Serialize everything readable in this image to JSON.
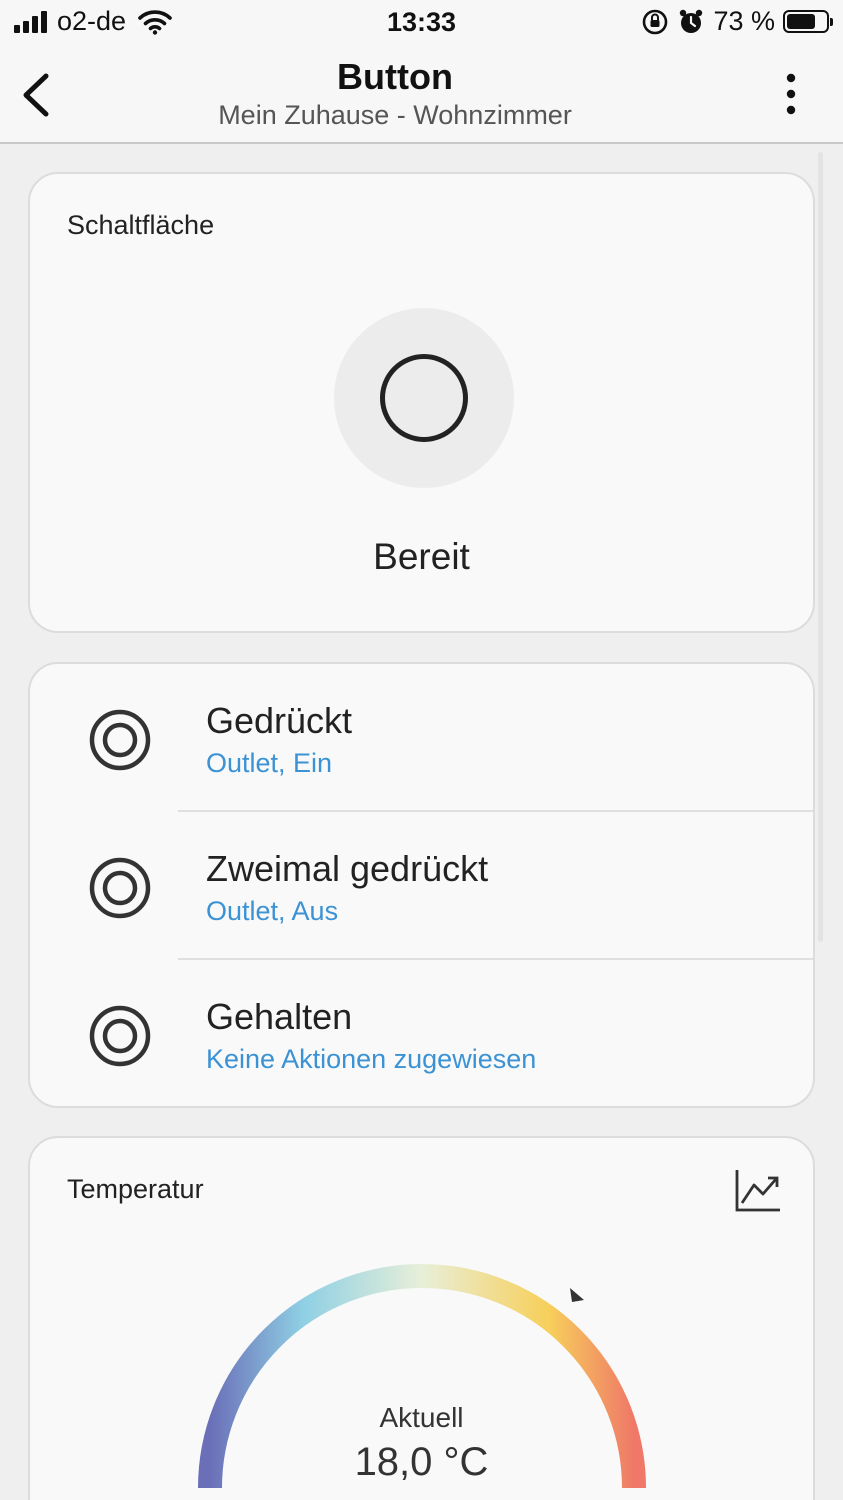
{
  "status_bar": {
    "carrier": "o2-de",
    "time": "13:33",
    "battery_percent": "73 %",
    "battery_level": 0.73
  },
  "nav": {
    "title": "Button",
    "subtitle": "Mein Zuhause - Wohnzimmer"
  },
  "button_card": {
    "title": "Schaltfläche",
    "state": "Bereit"
  },
  "actions": [
    {
      "label": "Gedrückt",
      "action": "Outlet, Ein"
    },
    {
      "label": "Zweimal gedrückt",
      "action": "Outlet, Aus"
    },
    {
      "label": "Gehalten",
      "action": "Keine Aktionen zugewiesen"
    }
  ],
  "temperature_card": {
    "title": "Temperatur",
    "current_label": "Aktuell",
    "current_value": "18,0 °C"
  },
  "colors": {
    "accent_link": "#3b92d4",
    "gauge_start": "#6a6fb8",
    "gauge_mid_blue": "#8fd0e4",
    "gauge_top": "#e8efd8",
    "gauge_yellow": "#f7cf5a",
    "gauge_end": "#ef7868"
  }
}
